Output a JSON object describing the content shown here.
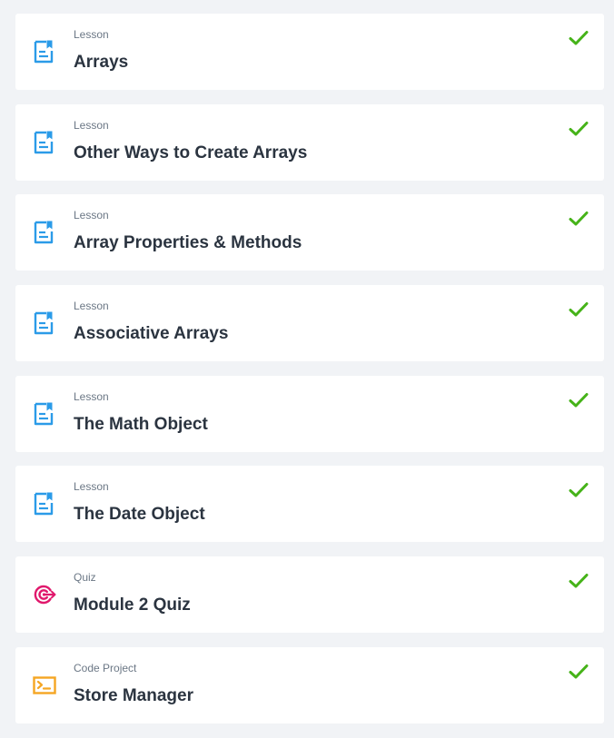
{
  "colors": {
    "background": "#f1f3f6",
    "card": "#ffffff",
    "lesson_icon": "#2b9be8",
    "quiz_icon": "#e0186c",
    "code_icon": "#f5a623",
    "check": "#46b319",
    "title_text": "#2b3440",
    "type_text": "#6b7785"
  },
  "items": [
    {
      "type": "Lesson",
      "title": "Arrays",
      "icon": "lesson-document-icon",
      "status": "completed"
    },
    {
      "type": "Lesson",
      "title": "Other Ways to Create Arrays",
      "icon": "lesson-document-icon",
      "status": "completed"
    },
    {
      "type": "Lesson",
      "title": "Array Properties & Methods",
      "icon": "lesson-document-icon",
      "status": "completed"
    },
    {
      "type": "Lesson",
      "title": "Associative Arrays",
      "icon": "lesson-document-icon",
      "status": "completed"
    },
    {
      "type": "Lesson",
      "title": "The Math Object",
      "icon": "lesson-document-icon",
      "status": "completed"
    },
    {
      "type": "Lesson",
      "title": "The Date Object",
      "icon": "lesson-document-icon",
      "status": "completed"
    },
    {
      "type": "Quiz",
      "title": "Module 2 Quiz",
      "icon": "quiz-target-icon",
      "status": "completed"
    },
    {
      "type": "Code Project",
      "title": "Store Manager",
      "icon": "code-terminal-icon",
      "status": "completed"
    }
  ]
}
